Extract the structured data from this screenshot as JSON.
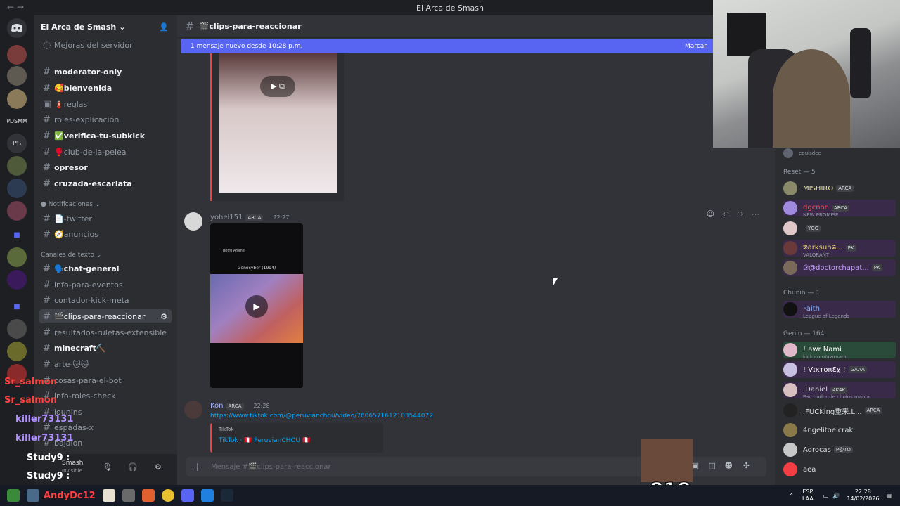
{
  "window": {
    "title": "El Arca de Smash"
  },
  "server": {
    "name": "El Arca de Smash",
    "boost_label": "Mejoras del servidor"
  },
  "servers": [
    "PDSMM",
    "PS"
  ],
  "channels_top": [
    {
      "name": "moderator-only",
      "unread": true
    },
    {
      "name": "🥰bienvenida",
      "unread": true
    },
    {
      "name": "🧯reglas",
      "unread": false
    },
    {
      "name": "roles-explicación",
      "unread": false
    },
    {
      "name": "✅verifica-tu-subkick",
      "unread": true
    },
    {
      "name": "🥊club-de-la-pelea",
      "unread": false
    },
    {
      "name": "opresor",
      "unread": true
    },
    {
      "name": "cruzada-escarlata",
      "unread": true
    }
  ],
  "categories": {
    "notifications": "Notificaciones",
    "text": "Canales de texto"
  },
  "channels_notif": [
    "📄-twitter",
    "🧭anuncios"
  ],
  "channels_text": [
    {
      "name": "🗣️chat-general",
      "unread": true
    },
    {
      "name": "info-para-eventos",
      "unread": false
    },
    {
      "name": "contador-kick-meta",
      "unread": false
    },
    {
      "name": "🎬clips-para-reaccionar",
      "active": true
    },
    {
      "name": "resultados-ruletas-extensible",
      "unread": false
    },
    {
      "name": "minecraft⛏️",
      "unread": true
    },
    {
      "name": "arte-🐱🐱",
      "unread": false
    },
    {
      "name": "cosas-para-el-bot",
      "unread": false
    },
    {
      "name": "info-roles-check",
      "unread": false
    },
    {
      "name": "iounins",
      "unread": false
    },
    {
      "name": "espadas-x",
      "unread": false
    },
    {
      "name": "bajalon",
      "unread": false
    }
  ],
  "channel_header": "🎬clips-para-reaccionar",
  "banner": {
    "text": "1 mensaje nuevo desde 10:28 p.m.",
    "action": "Marcar"
  },
  "messages": [
    {
      "author": "yohel151",
      "badge": "ARCA",
      "time": "22:27",
      "video_title": "Genocyber (1994)",
      "video_source": "Retro Anime"
    },
    {
      "author": "Kon",
      "badge": "ARCA",
      "time": "22:28",
      "link": "https://www.tiktok.com/@peruvianchou/video/7606571612103544072",
      "embed_provider": "TikTok",
      "embed_title": "TikTok · 🇵🇪 PeruvianCHOU 🇵🇪"
    }
  ],
  "composer": {
    "placeholder": "Mensaje #🎬clips-para-reaccionar"
  },
  "user_panel": {
    "name": "Smash",
    "status": "Invisible"
  },
  "members": {
    "top_partial": "equisdee",
    "groups": [
      {
        "label": "Reset — 5",
        "items": [
          {
            "name": "MISHIRO",
            "tag": "ARCA"
          },
          {
            "name": "dgcnon",
            "tag": "ARCA",
            "sub": "NEW PROMISE"
          },
          {
            "name": "",
            "tag": "YGO"
          },
          {
            "name": "𝕯arksun𝕾...",
            "tag": "PK",
            "sub": "VALORANT"
          },
          {
            "name": "𝒟@doctorchapat...",
            "tag": "PK"
          }
        ]
      },
      {
        "label": "Chunin — 1",
        "items": [
          {
            "name": "Faith",
            "sub": "League of Legends"
          }
        ]
      },
      {
        "label": "Genin — 164",
        "items": [
          {
            "name": "! awr Nami",
            "sub": "kick.com/awrnami"
          },
          {
            "name": "! VɪᴋᴛᴏʀƐχ !",
            "tag": "GAAA"
          },
          {
            "name": ".Daniel",
            "tag": "4K4K",
            "sub": "Parchador de cholos marca"
          },
          {
            "name": ".FUCKing重来.L...",
            "tag": "ARCA"
          },
          {
            "name": "4ngelitoelcrak"
          },
          {
            "name": "Adrocas",
            "tag": "P@TO"
          },
          {
            "name": "aea"
          }
        ]
      }
    ]
  },
  "chat_overlay": [
    "Sr_salmon",
    "Sr_salmon",
    "killer73131",
    "killer73131",
    "Study9 :",
    "Study9 :"
  ],
  "overlay_counter": "x818",
  "taskbar": {
    "lang": "ESP",
    "lang2": "LAA",
    "time": "22:28",
    "date": "14/02/2026",
    "user_overlay": "AndyDc12"
  },
  "colors": {
    "accent": "#5865f2",
    "link": "#00a8fc"
  }
}
